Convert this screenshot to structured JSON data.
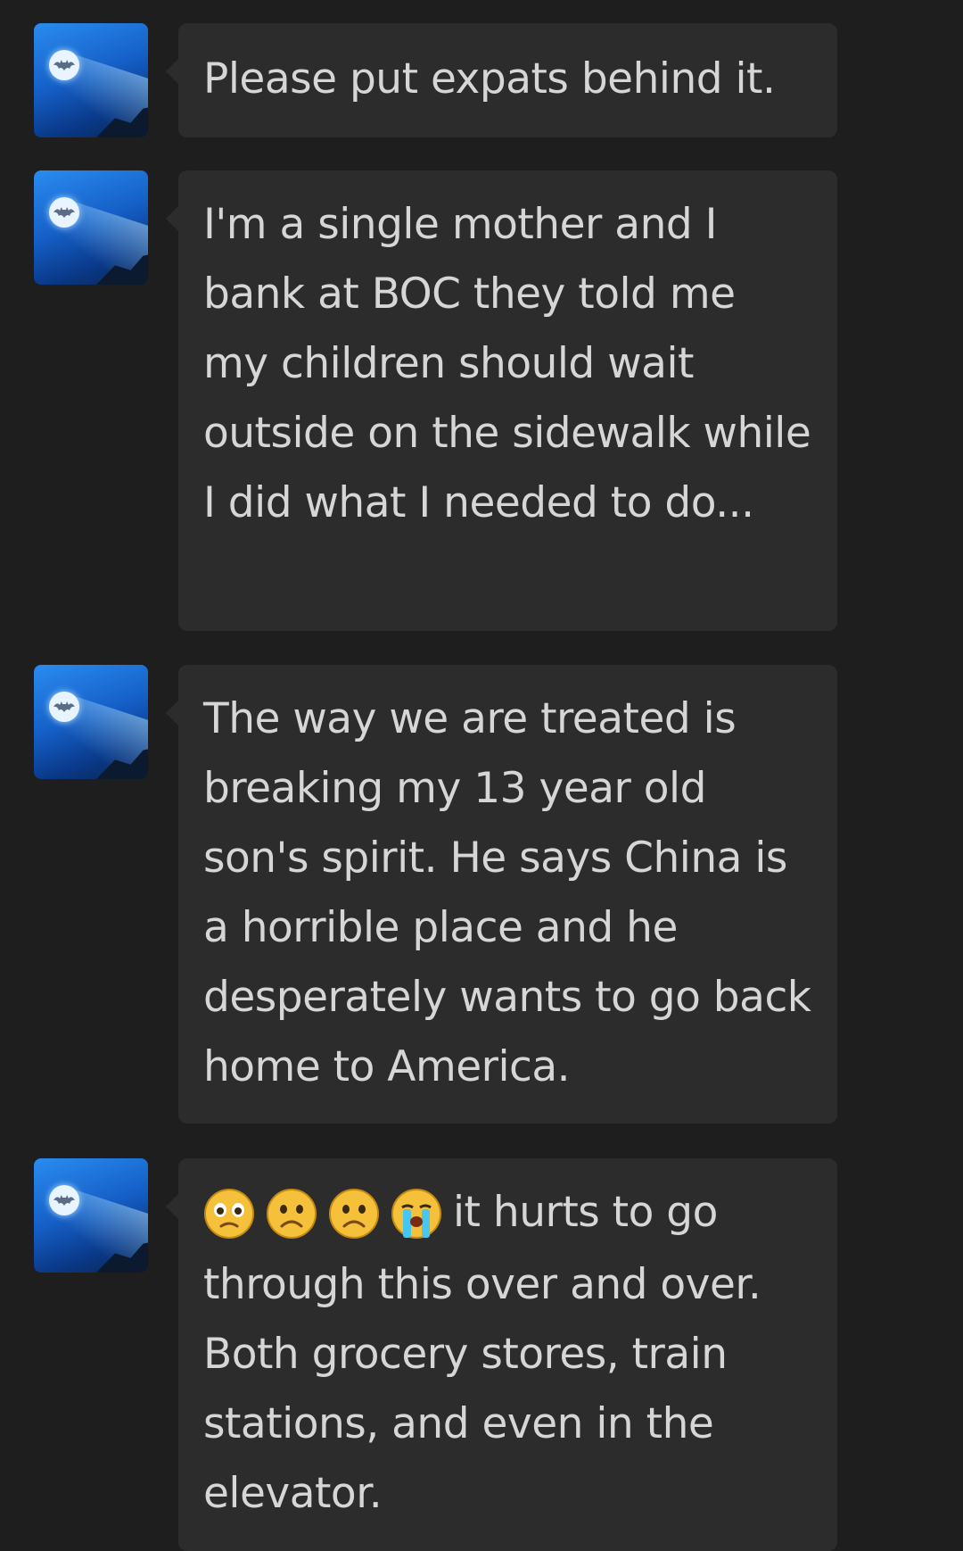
{
  "chat": {
    "messages": [
      {
        "avatar_icon": "batman-signal-avatar-icon",
        "text": "Please put expats behind it."
      },
      {
        "avatar_icon": "batman-signal-avatar-icon",
        "text": "I'm a single mother and I bank at BOC they told me my children should wait outside on the sidewalk while I did what I needed to do..."
      },
      {
        "avatar_icon": "batman-signal-avatar-icon",
        "text": "The way we are treated is breaking my 13 year old son's spirit. He says China is a horrible place and he desperately wants to go back home to America."
      },
      {
        "avatar_icon": "batman-signal-avatar-icon",
        "emojis": [
          "pleading-face-icon",
          "frowning-face-icon",
          "frowning-face-icon",
          "loudly-crying-face-icon"
        ],
        "text": "it hurts to go through this over and over. Both grocery stores, train stations, and even in the elevator."
      }
    ]
  },
  "colors": {
    "background": "#1e1e1e",
    "bubble": "#2c2c2c",
    "text": "#d6d6d6"
  }
}
